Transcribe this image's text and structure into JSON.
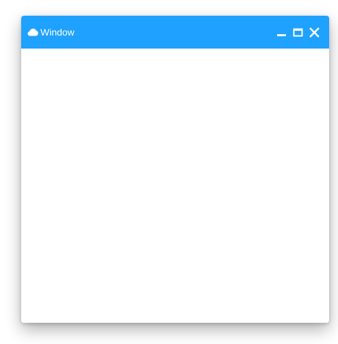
{
  "window": {
    "title": "Window",
    "title_icon": "cloud-icon",
    "controls": {
      "minimize_icon": "minimize-icon",
      "maximize_icon": "maximize-icon",
      "close_icon": "close-icon"
    }
  },
  "colors": {
    "titlebar": "#1ea1ff",
    "title_text": "#ffffff",
    "content_background": "#ffffff"
  }
}
